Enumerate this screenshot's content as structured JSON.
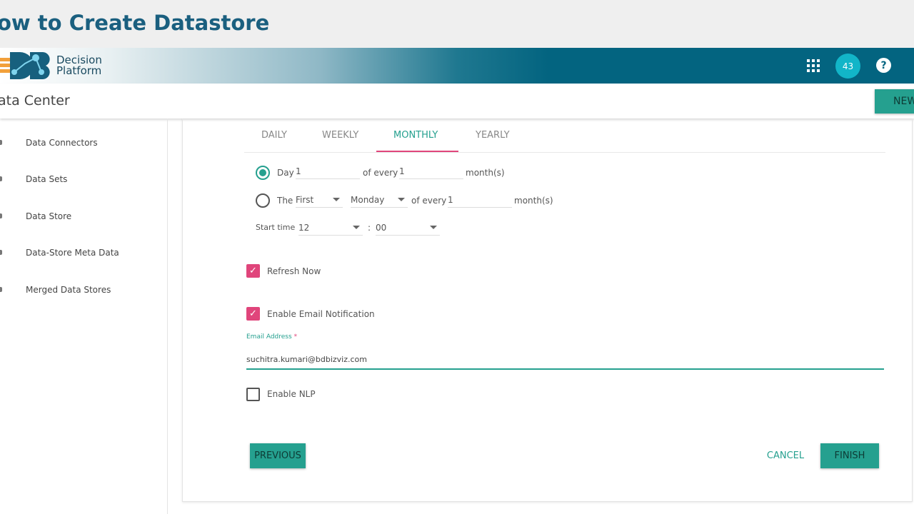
{
  "video_title": "ow to Create Datastore",
  "brand": {
    "line1": "Decision",
    "line2": "Platform"
  },
  "header": {
    "notification_count": "43",
    "apps_icon": "grid-icon",
    "help_icon": "question-icon"
  },
  "page_title": "ata Center",
  "new_button": "NEW",
  "sidebar": {
    "items": [
      {
        "label": "Data Connectors"
      },
      {
        "label": "Data Sets"
      },
      {
        "label": "Data Store"
      },
      {
        "label": "Data-Store Meta Data"
      },
      {
        "label": "Merged Data Stores"
      }
    ]
  },
  "tabs": [
    {
      "label": "DAILY"
    },
    {
      "label": "WEEKLY"
    },
    {
      "label": "MONTHLY",
      "active": true
    },
    {
      "label": "YEARLY"
    }
  ],
  "schedule": {
    "option1": {
      "label": "Day",
      "day": "1",
      "of_every": "of every",
      "months": "1",
      "unit": "month(s)",
      "selected": true
    },
    "option2": {
      "label": "The",
      "ordinal": "First",
      "weekday": "Monday",
      "of_every": "of every",
      "months": "1",
      "unit": "month(s)",
      "selected": false
    },
    "start_time": {
      "label": "Start time",
      "hour": "12",
      "sep": ":",
      "minute": "00"
    }
  },
  "refresh_now": {
    "label": "Refresh Now",
    "checked": true
  },
  "email_notification": {
    "label": "Enable Email Notification",
    "checked": true
  },
  "email": {
    "label": "Email Address",
    "required": "*",
    "value": "suchitra.kumari@bdbizviz.com"
  },
  "nlp": {
    "label": "Enable NLP",
    "checked": false
  },
  "buttons": {
    "previous": "PREVIOUS",
    "cancel": "CANCEL",
    "finish": "FINISH"
  },
  "colors": {
    "accent": "#25a08f",
    "pink": "#e0457b",
    "header": "#036480"
  }
}
